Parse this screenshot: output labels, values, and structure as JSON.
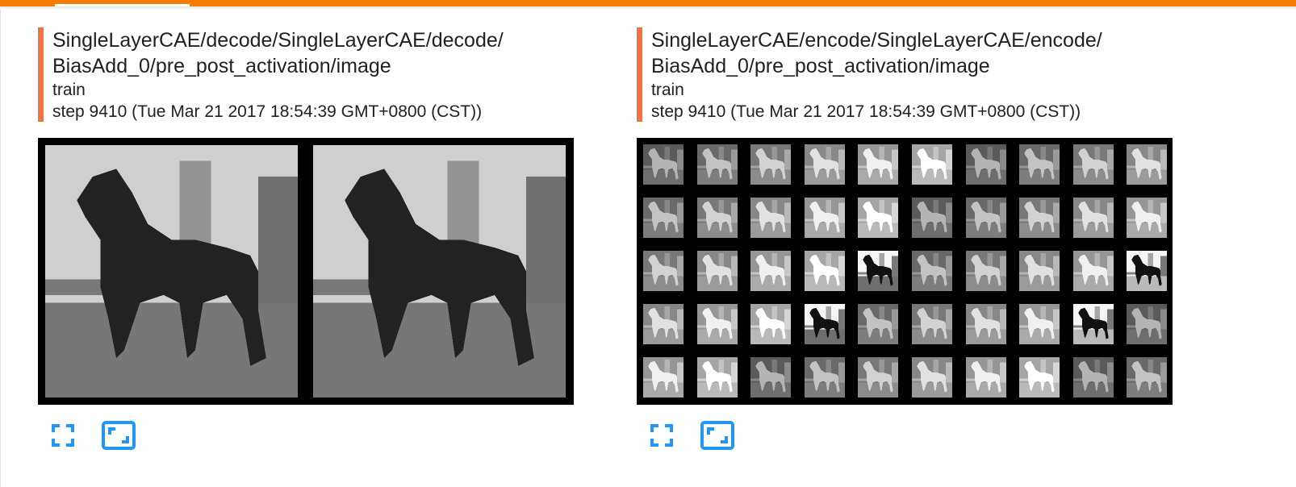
{
  "cards": [
    {
      "title_line1": "SingleLayerCAE/decode/SingleLayerCAE/decode/",
      "title_line2": "BiasAdd_0/pre_post_activation/image",
      "run": "train",
      "step": "step 9410 (Tue Mar 21 2017 18:54:39 GMT+0800 (CST))",
      "image_description": "two decoded grayscale horse images",
      "actions": [
        "fullscreen-icon",
        "fit-image-icon"
      ]
    },
    {
      "title_line1": "SingleLayerCAE/encode/SingleLayerCAE/encode/",
      "title_line2": "BiasAdd_0/pre_post_activation/image",
      "run": "train",
      "step": "step 9410 (Tue Mar 21 2017 18:54:39 GMT+0800 (CST))",
      "image_description": "grid of 5 x 10 encoded feature maps",
      "actions": [
        "fullscreen-icon",
        "fit-image-icon"
      ]
    }
  ],
  "colors": {
    "accent": "#f57c00",
    "card_border": "#f4723d",
    "icon_blue": "#2196f3",
    "text": "#212121"
  },
  "encode_grid": {
    "rows": 5,
    "cols": 10,
    "dark_tiles": [
      [
        2,
        4
      ],
      [
        2,
        9
      ],
      [
        3,
        3
      ],
      [
        3,
        8
      ]
    ]
  }
}
